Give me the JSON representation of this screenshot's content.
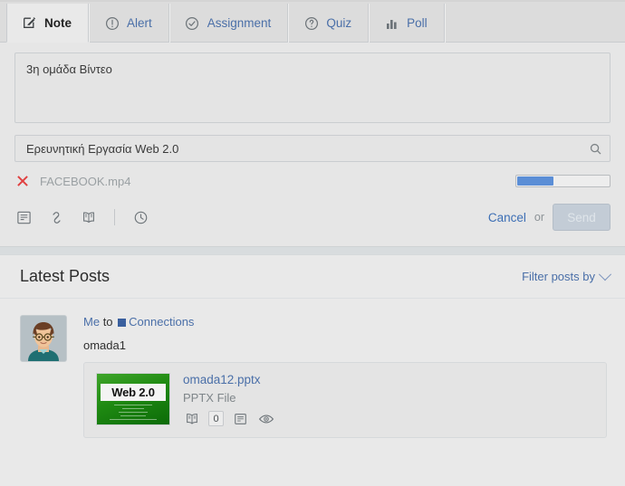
{
  "composer": {
    "tabs": [
      {
        "label": "Note",
        "icon": "compose-icon",
        "active": true
      },
      {
        "label": "Alert",
        "icon": "alert-circle-icon",
        "active": false
      },
      {
        "label": "Assignment",
        "icon": "check-circle-icon",
        "active": false
      },
      {
        "label": "Quiz",
        "icon": "question-circle-icon",
        "active": false
      },
      {
        "label": "Poll",
        "icon": "bar-chart-icon",
        "active": false
      }
    ],
    "note_value": "3η ομάδα Βίντεο",
    "note_placeholder": "",
    "title_value": "Ερευνητική Εργασία Web 2.0",
    "title_placeholder": "",
    "search_icon": "search-icon",
    "upload": {
      "remove_icon": "remove-x-icon",
      "filename": "FACEBOOK.mp4",
      "progress_percent": 40,
      "progress_color": "#5b8ed6"
    },
    "tools": [
      {
        "icon": "note-icon"
      },
      {
        "icon": "link-icon"
      },
      {
        "icon": "book-icon"
      },
      {
        "icon": "clock-icon"
      }
    ],
    "cancel_label": "Cancel",
    "or_label": "or",
    "send_label": "Send"
  },
  "posts": {
    "title": "Latest Posts",
    "filter_label": "Filter posts by",
    "filter_chevron": "chevron-down-icon",
    "items": [
      {
        "avatar": "user-avatar",
        "author": "Me",
        "to_label": "to",
        "audience": "Connections",
        "audience_icon": "connections-square-icon",
        "body": "omada1",
        "attachment": {
          "thumb_text": "Web 2.0",
          "name": "omada12.pptx",
          "type": "PPTX File",
          "count": "0",
          "icons": [
            "book-icon",
            "note-icon",
            "eye-icon"
          ]
        }
      }
    ]
  },
  "colors": {
    "link": "#4a6fa8",
    "accent": "#3a5f9e",
    "danger": "#e04040",
    "panel_bg": "#e9e9e9",
    "tabbar_bg": "#dcdcdc"
  }
}
